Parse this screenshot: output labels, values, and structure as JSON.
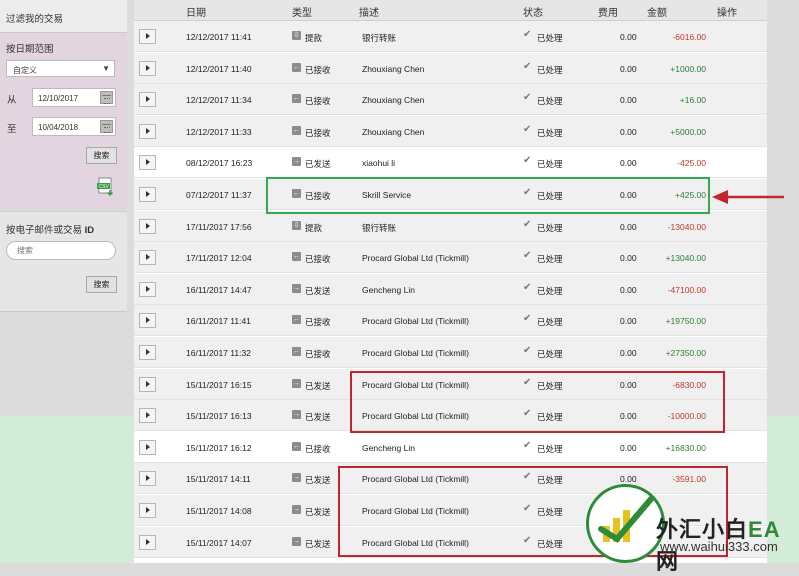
{
  "sidebar": {
    "title": "过滤我的交易",
    "date_section": {
      "label": "按日期范围",
      "range_select": "自定义",
      "from_label": "从",
      "from_value": "12/10/2017",
      "to_label": "至",
      "to_value": "10/04/2018",
      "search_button": "搜索"
    },
    "id_section": {
      "label": "按电子邮件或交易",
      "label_bold": "ID",
      "search_placeholder": "搜索",
      "search_button": "搜索"
    }
  },
  "table": {
    "headers": [
      "日期",
      "类型",
      "描述",
      "状态",
      "费用",
      "金额",
      "操作"
    ],
    "rows": [
      {
        "date": "12/12/2017 11:41",
        "type": "提款",
        "type_icon": "download-icon",
        "desc": "银行转账",
        "status": "已处理",
        "fee": "0.00",
        "amount": "-6016.00",
        "sign": "neg"
      },
      {
        "date": "12/12/2017 11:40",
        "type": "已接收",
        "type_icon": "arrow-left-icon",
        "desc": "Zhouxiang Chen",
        "status": "已处理",
        "fee": "0.00",
        "amount": "+1000.00",
        "sign": "pos"
      },
      {
        "date": "12/12/2017 11:34",
        "type": "已接收",
        "type_icon": "arrow-left-icon",
        "desc": "Zhouxiang Chen",
        "status": "已处理",
        "fee": "0.00",
        "amount": "+16.00",
        "sign": "pos"
      },
      {
        "date": "12/12/2017 11:33",
        "type": "已接收",
        "type_icon": "arrow-left-icon",
        "desc": "Zhouxiang Chen",
        "status": "已处理",
        "fee": "0.00",
        "amount": "+5000.00",
        "sign": "pos"
      },
      {
        "date": "08/12/2017 16:23",
        "type": "已发送",
        "type_icon": "arrow-right-icon",
        "desc": "xiaohui li",
        "status": "已处理",
        "fee": "0.00",
        "amount": "-425.00",
        "sign": "neg"
      },
      {
        "date": "07/12/2017 11:37",
        "type": "已接收",
        "type_icon": "arrow-left-icon",
        "desc": "Skrill Service",
        "status": "已处理",
        "fee": "0.00",
        "amount": "+425.00",
        "sign": "pos"
      },
      {
        "date": "17/11/2017 17:56",
        "type": "提款",
        "type_icon": "download-icon",
        "desc": "银行转账",
        "status": "已处理",
        "fee": "0.00",
        "amount": "-13040.00",
        "sign": "neg"
      },
      {
        "date": "17/11/2017 12:04",
        "type": "已接收",
        "type_icon": "arrow-left-icon",
        "desc": "Procard Global Ltd (Tickmill)",
        "status": "已处理",
        "fee": "0.00",
        "amount": "+13040.00",
        "sign": "pos"
      },
      {
        "date": "16/11/2017 14:47",
        "type": "已发送",
        "type_icon": "arrow-right-icon",
        "desc": "Gencheng Lin",
        "status": "已处理",
        "fee": "0.00",
        "amount": "-47100.00",
        "sign": "neg"
      },
      {
        "date": "16/11/2017 11:41",
        "type": "已接收",
        "type_icon": "arrow-left-icon",
        "desc": "Procard Global Ltd (Tickmill)",
        "status": "已处理",
        "fee": "0.00",
        "amount": "+19750.00",
        "sign": "pos"
      },
      {
        "date": "16/11/2017 11:32",
        "type": "已接收",
        "type_icon": "arrow-left-icon",
        "desc": "Procard Global Ltd (Tickmill)",
        "status": "已处理",
        "fee": "0.00",
        "amount": "+27350.00",
        "sign": "pos"
      },
      {
        "date": "15/11/2017 16:15",
        "type": "已发送",
        "type_icon": "arrow-right-icon",
        "desc": "Procard Global Ltd (Tickmill)",
        "status": "已处理",
        "fee": "0.00",
        "amount": "-6830.00",
        "sign": "neg"
      },
      {
        "date": "15/11/2017 16:13",
        "type": "已发送",
        "type_icon": "arrow-right-icon",
        "desc": "Procard Global Ltd (Tickmill)",
        "status": "已处理",
        "fee": "0.00",
        "amount": "-10000.00",
        "sign": "neg"
      },
      {
        "date": "15/11/2017 16:12",
        "type": "已接收",
        "type_icon": "arrow-left-icon",
        "desc": "Gencheng Lin",
        "status": "已处理",
        "fee": "0.00",
        "amount": "+16830.00",
        "sign": "pos"
      },
      {
        "date": "15/11/2017 14:11",
        "type": "已发送",
        "type_icon": "arrow-right-icon",
        "desc": "Procard Global Ltd (Tickmill)",
        "status": "已处理",
        "fee": "0.00",
        "amount": "-3591.00",
        "sign": "neg"
      },
      {
        "date": "15/11/2017 14:08",
        "type": "已发送",
        "type_icon": "arrow-right-icon",
        "desc": "Procard Global Ltd (Tickmill)",
        "status": "已处理",
        "fee": "",
        "amount": "",
        "sign": "neg"
      },
      {
        "date": "15/11/2017 14:07",
        "type": "已发送",
        "type_icon": "arrow-right-icon",
        "desc": "Procard Global Ltd (Tickmill)",
        "status": "已处理",
        "fee": "",
        "amount": "",
        "sign": "neg"
      }
    ]
  },
  "watermark": {
    "title_cn": "外汇小白",
    "title_ea": "EA",
    "title_end": "网",
    "url": "www.waihui333.com"
  },
  "colors": {
    "highlight_green": "#34a853",
    "highlight_red": "#c0262b",
    "amount_negative": "#c0392b",
    "amount_positive": "#2e7d32"
  }
}
